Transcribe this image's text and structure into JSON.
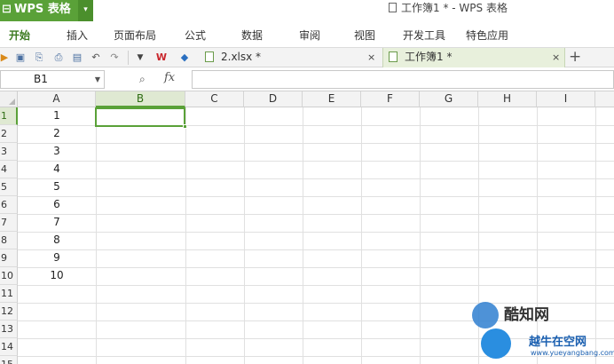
{
  "app": {
    "button_label": "WPS 表格",
    "document_title": "工作簿1 * - WPS 表格"
  },
  "menu": [
    "开始",
    "插入",
    "页面布局",
    "公式",
    "数据",
    "审阅",
    "视图",
    "开发工具",
    "特色应用"
  ],
  "tabs": [
    {
      "label": "2.xlsx *",
      "close": "×"
    },
    {
      "label": "工作簿1 *",
      "close": "×"
    }
  ],
  "new_tab_label": "+",
  "formula_bar": {
    "name_box": "B1",
    "fx_label": "fx",
    "formula": ""
  },
  "columns": [
    "A",
    "B",
    "C",
    "D",
    "E",
    "F",
    "G",
    "H",
    "I"
  ],
  "rows": [
    "1",
    "2",
    "3",
    "4",
    "5",
    "6",
    "7",
    "8",
    "9",
    "10",
    "11",
    "12",
    "13",
    "14",
    "15"
  ],
  "cells_A": [
    "1",
    "2",
    "3",
    "4",
    "5",
    "6",
    "7",
    "8",
    "9",
    "10",
    "",
    "",
    "",
    "",
    ""
  ],
  "selected_cell": "B1",
  "watermark": {
    "line1": "酷知网",
    "line2": "越牛在空网",
    "line3": "www.yueyangbang.com"
  },
  "colors": {
    "accent": "#5aa138",
    "selection_header": "#dfe9d2"
  }
}
